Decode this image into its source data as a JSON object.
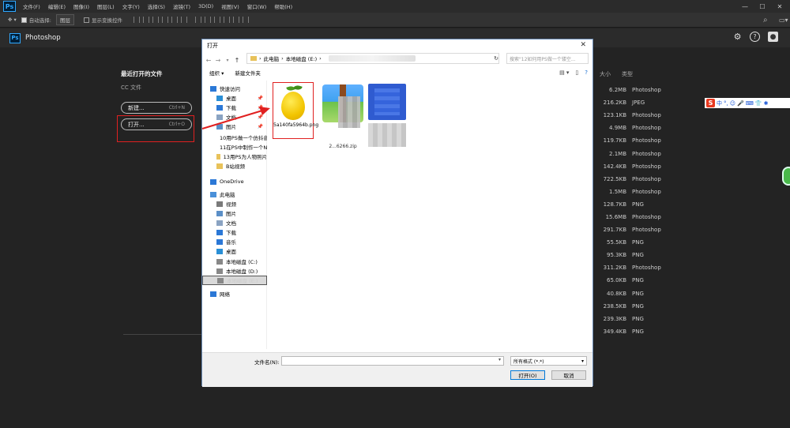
{
  "menubar": {
    "logo": "Ps",
    "items": [
      "文件(F)",
      "编辑(E)",
      "图像(I)",
      "图层(L)",
      "文字(Y)",
      "选择(S)",
      "滤镜(T)",
      "3D(D)",
      "视图(V)",
      "窗口(W)",
      "帮助(H)"
    ],
    "min": "—",
    "max": "☐",
    "close": "✕"
  },
  "options": {
    "auto_select": "自动选择:",
    "layer_select": "图层",
    "show_transform": "显示变换控件"
  },
  "workspace": {
    "logo": "Ps",
    "title": "Photoshop"
  },
  "left_panel": {
    "recent_title": "最近打开的文件",
    "cc_files": "CC 文件",
    "new_label": "新建...",
    "new_shortcut": "Ctrl+N",
    "open_label": "打开...",
    "open_shortcut": "Ctrl+O"
  },
  "list": {
    "col_size": "大小",
    "col_type": "类型",
    "rows": [
      {
        "size": "6.2MB",
        "type": "Photoshop"
      },
      {
        "size": "216.2KB",
        "type": "JPEG"
      },
      {
        "size": "123.1KB",
        "type": "Photoshop"
      },
      {
        "size": "4.9MB",
        "type": "Photoshop"
      },
      {
        "size": "119.7KB",
        "type": "Photoshop"
      },
      {
        "size": "2.1MB",
        "type": "Photoshop"
      },
      {
        "size": "142.4KB",
        "type": "Photoshop"
      },
      {
        "size": "722.5KB",
        "type": "Photoshop"
      },
      {
        "size": "1.5MB",
        "type": "Photoshop"
      },
      {
        "size": "128.7KB",
        "type": "PNG"
      },
      {
        "size": "15.6MB",
        "type": "Photoshop"
      },
      {
        "size": "291.7KB",
        "type": "Photoshop"
      },
      {
        "size": "55.5KB",
        "type": "PNG"
      },
      {
        "size": "95.3KB",
        "type": "PNG"
      },
      {
        "size": "311.2KB",
        "type": "Photoshop"
      },
      {
        "size": "65.0KB",
        "type": "PNG"
      },
      {
        "size": "40.8KB",
        "type": "PNG"
      },
      {
        "size": "238.5KB",
        "type": "PNG"
      },
      {
        "size": "239.3KB",
        "type": "PNG"
      },
      {
        "size": "349.4KB",
        "type": "PNG"
      }
    ]
  },
  "ime": {
    "logo": "S",
    "mode": "中"
  },
  "dialog": {
    "title": "打开",
    "address": {
      "pc": "此电脑",
      "sep": "›",
      "drive": "本地磁盘 (E:)"
    },
    "search_placeholder": "搜索\"12如何用PS做一个镂空...",
    "organize": "组织 ▾",
    "new_folder": "新建文件夹",
    "sidebar": [
      {
        "label": "快速访问",
        "kind": "quick"
      },
      {
        "label": "桌面",
        "kind": "folder-blue",
        "pinned": true
      },
      {
        "label": "下载",
        "kind": "download",
        "pinned": true
      },
      {
        "label": "文档",
        "kind": "doc",
        "pinned": true
      },
      {
        "label": "图片",
        "kind": "pic",
        "pinned": true
      },
      {
        "label": "10用PS做一个仿抖音",
        "kind": "folder"
      },
      {
        "label": "11在PS中制作一个N",
        "kind": "folder"
      },
      {
        "label": "13用PS为人物照片",
        "kind": "folder"
      },
      {
        "label": "B站视频",
        "kind": "folder"
      },
      {
        "label": "OneDrive",
        "kind": "cloud"
      },
      {
        "label": "此电脑",
        "kind": "pc"
      },
      {
        "label": "视频",
        "kind": "video"
      },
      {
        "label": "图片",
        "kind": "pic"
      },
      {
        "label": "文档",
        "kind": "doc"
      },
      {
        "label": "下载",
        "kind": "download"
      },
      {
        "label": "音乐",
        "kind": "music"
      },
      {
        "label": "桌面",
        "kind": "folder-blue"
      },
      {
        "label": "本地磁盘 (C:)",
        "kind": "drive"
      },
      {
        "label": "本地磁盘 (D:)",
        "kind": "drive"
      },
      {
        "label": "本地磁盘 (E:)",
        "kind": "drive",
        "selected": true
      },
      {
        "label": "网络",
        "kind": "net"
      }
    ],
    "files": [
      {
        "name": "5a140fa5964b.png",
        "kind": "lemon"
      },
      {
        "name": "2...6266.zip",
        "kind": "archive"
      }
    ],
    "filename_label": "文件名(N):",
    "filetype": "所有格式 (*.*)",
    "open_btn": "打开(O)",
    "cancel_btn": "取消"
  },
  "colors": {
    "highlight_red": "#e02020",
    "ps_blue": "#31a8ff"
  }
}
